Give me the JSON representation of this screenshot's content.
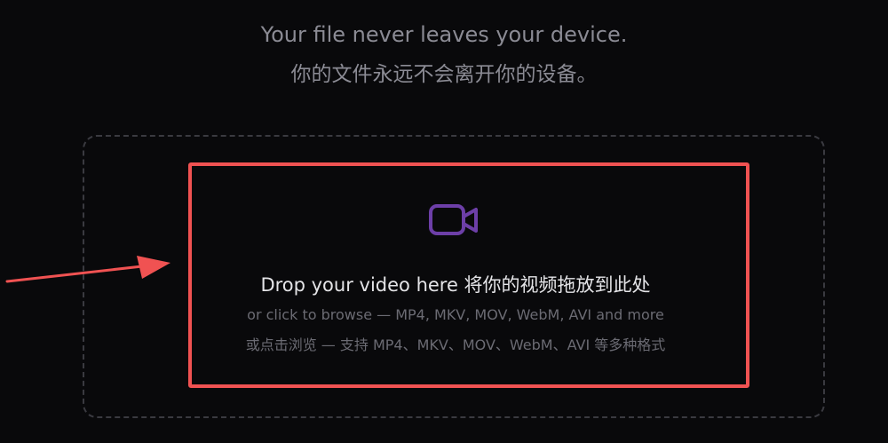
{
  "header": {
    "tagline_en": "Your file never leaves your device.",
    "tagline_zh": "你的文件永远不会离开你的设备。"
  },
  "dropzone": {
    "title": "Drop your video here 将你的视频拖放到此处",
    "subtitle_en": "or click to browse — MP4, MKV, MOV, WebM, AVI and more",
    "subtitle_zh": "或点击浏览 — 支持 MP4、MKV、MOV、WebM、AVI 等多种格式",
    "icon": "video-camera-icon"
  },
  "annotation": {
    "arrow_color": "#f05252",
    "box_color": "#f05252"
  },
  "colors": {
    "background": "#09090b",
    "icon_accent": "#6d3fa8"
  }
}
